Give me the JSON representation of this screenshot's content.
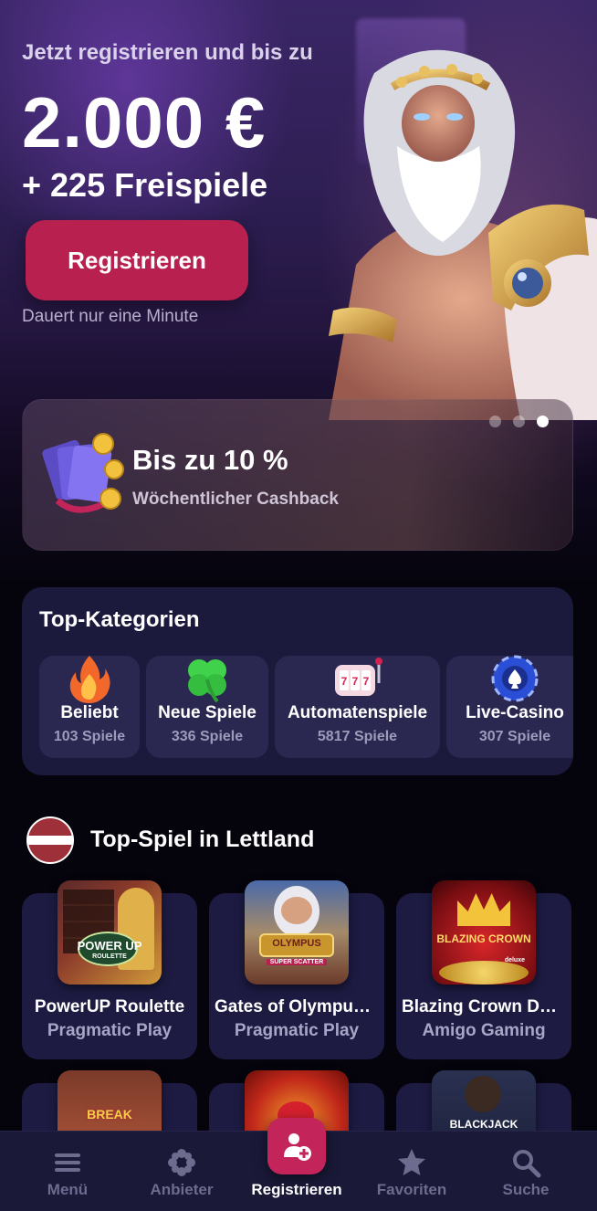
{
  "hero": {
    "title": "Jetzt registrieren und bis zu",
    "amount": "2.000 €",
    "bonus": "+ 225 Freispiele",
    "register_label": "Registrieren",
    "note": "Dauert nur eine Minute"
  },
  "promo": {
    "title": "Bis zu 10 %",
    "subtitle": "Wöchentlicher Cashback",
    "carousel": {
      "slides": 3,
      "active_index": 2
    }
  },
  "categories": {
    "title": "Top-Kategorien",
    "items": [
      {
        "name": "Beliebt",
        "count": "103 Spiele",
        "icon": "flame-icon"
      },
      {
        "name": "Neue Spiele",
        "count": "336 Spiele",
        "icon": "clover-icon"
      },
      {
        "name": "Automatenspiele",
        "count": "5817 Spiele",
        "icon": "slot-machine-icon"
      },
      {
        "name": "Live-Casino",
        "count": "307 Spiele",
        "icon": "poker-chip-icon"
      }
    ]
  },
  "top_games": {
    "title": "Top-Spiel in Lettland",
    "flag": "latvia-flag-icon",
    "games": [
      {
        "name": "PowerUP Roulette",
        "provider": "Pragmatic Play",
        "thumb_text": "POWER UP",
        "thumb_sub": "ROULETTE"
      },
      {
        "name": "Gates of Olympus Super Scatter",
        "provider": "Pragmatic Play",
        "thumb_text": "OLYMPUS",
        "thumb_sub": "SUPER SCATTER"
      },
      {
        "name": "Blazing Crown Deluxe",
        "provider": "Amigo Gaming",
        "thumb_text": "BLAZING CROWN",
        "thumb_sub": "deluxe"
      },
      {
        "name": "",
        "provider": "",
        "thumb_text": "BREAK"
      },
      {
        "name": "",
        "provider": "",
        "thumb_text": ""
      },
      {
        "name": "",
        "provider": "",
        "thumb_text": "BLACKJACK"
      }
    ]
  },
  "bottom_nav": {
    "items": [
      {
        "label": "Menü",
        "icon": "menu-icon"
      },
      {
        "label": "Anbieter",
        "icon": "providers-icon"
      },
      {
        "label": "Registrieren",
        "icon": "add-user-icon",
        "active": true
      },
      {
        "label": "Favoriten",
        "icon": "star-icon"
      },
      {
        "label": "Suche",
        "icon": "search-icon"
      }
    ]
  },
  "colors": {
    "accent": "#b8214f",
    "card": "#1c1a3c",
    "nav_bg": "#1a1938",
    "muted_text": "#a8a6c6"
  }
}
